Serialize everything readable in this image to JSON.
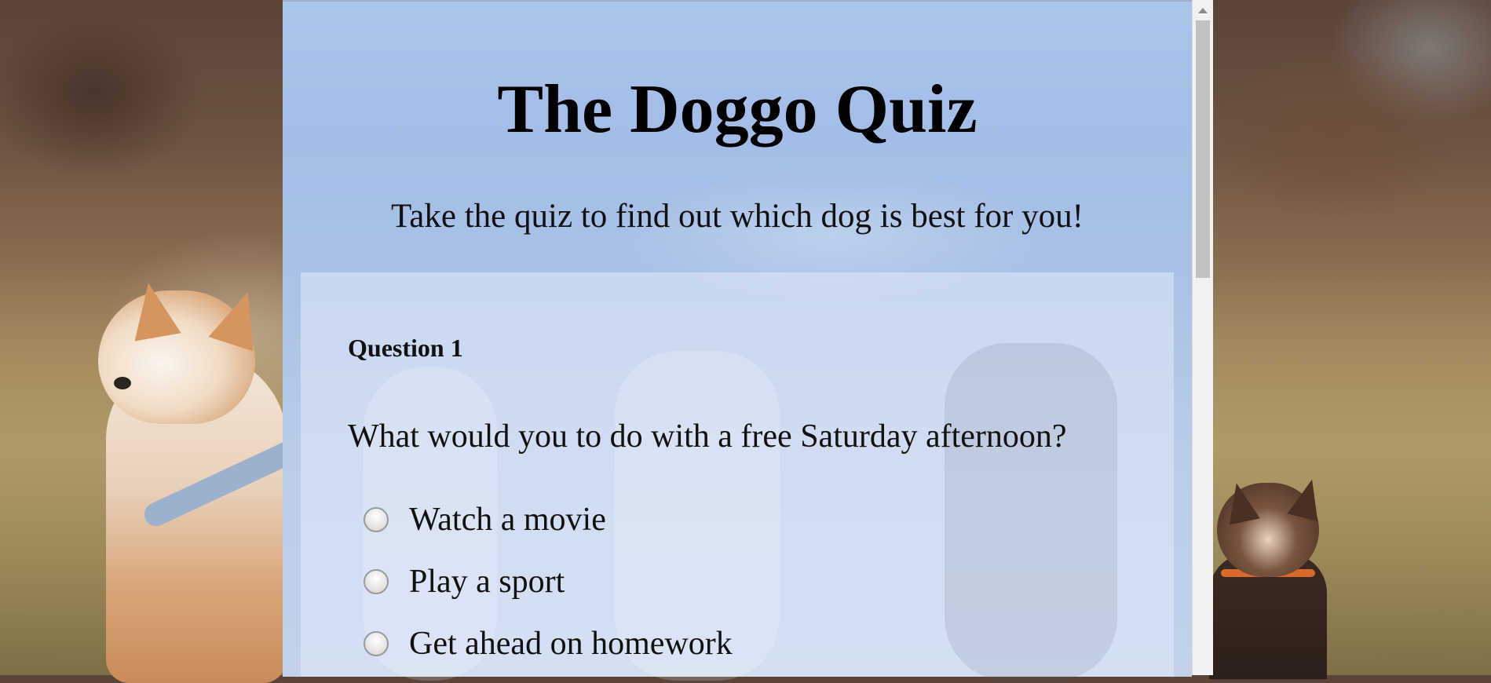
{
  "page": {
    "title": "The Doggo Quiz",
    "subtitle": "Take the quiz to find out which dog is best for you!"
  },
  "quiz": {
    "question_number": "Question 1",
    "question_text": "What would you to do with a free Saturday afternoon?",
    "options": [
      {
        "label": "Watch a movie",
        "selected": false
      },
      {
        "label": "Play a sport",
        "selected": false
      },
      {
        "label": "Get ahead on homework",
        "selected": false
      }
    ]
  },
  "colors": {
    "panel_background": "#a9c1e8",
    "card_background": "#e1ebf8",
    "text": "#111111"
  },
  "icons": {
    "scroll_up": "triangle-up-icon"
  }
}
